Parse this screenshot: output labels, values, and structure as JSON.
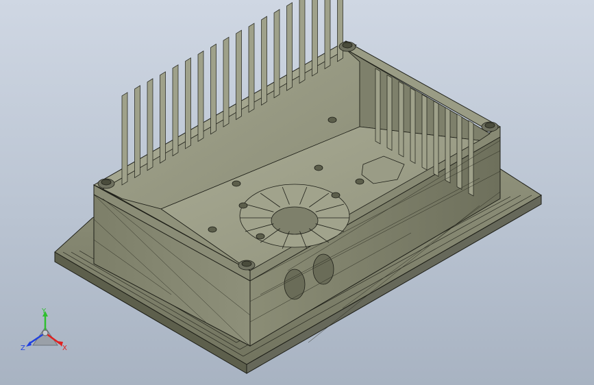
{
  "viewport": {
    "background_top": "#cfd7e3",
    "background_bottom": "#a8b3c2",
    "model": {
      "face_color": "#8d8f78",
      "edge_color": "#1c1d16"
    }
  },
  "triad": {
    "y_label": "Y",
    "x_label": "X",
    "z_label": "Z",
    "x_color": "#e02020",
    "y_color": "#2fbf2f",
    "z_color": "#2040e0"
  }
}
